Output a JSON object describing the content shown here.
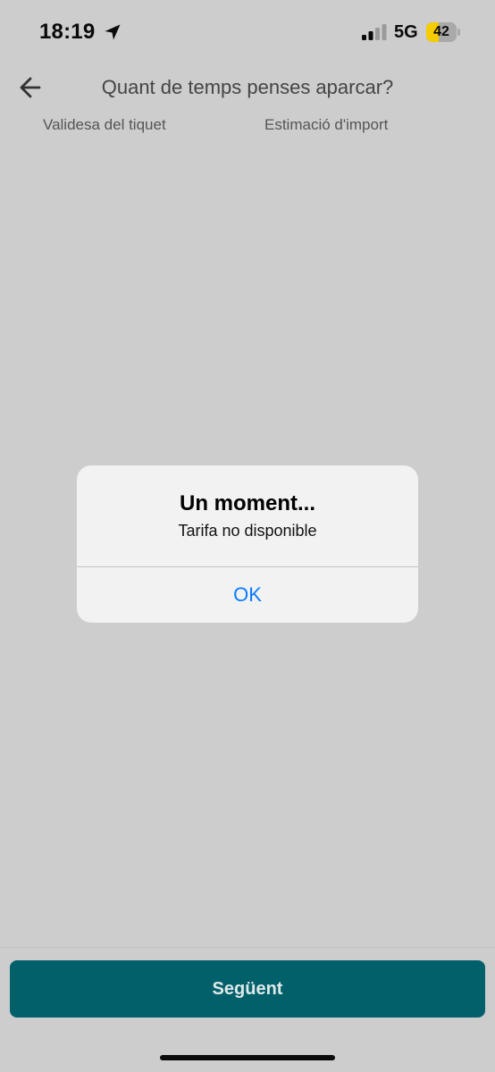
{
  "status_bar": {
    "time": "18:19",
    "network": "5G",
    "battery_level": "42",
    "battery_fraction": 0.42,
    "location_icon": "location-arrow-icon",
    "signal_icon": "cellular-signal-icon"
  },
  "header": {
    "back_icon": "arrow-left-icon",
    "title": "Quant de temps penses aparcar?"
  },
  "columns": {
    "left_label": "Validesa del tiquet",
    "right_label": "Estimació d'import"
  },
  "alert": {
    "title": "Un moment...",
    "message": "Tarifa no disponible",
    "ok_label": "OK"
  },
  "footer": {
    "next_label": "Següent"
  },
  "colors": {
    "background": "#cdcdcd",
    "primary_button": "#02606a",
    "alert_button_text": "#0a7aff",
    "battery_fill": "#f5cc00"
  }
}
